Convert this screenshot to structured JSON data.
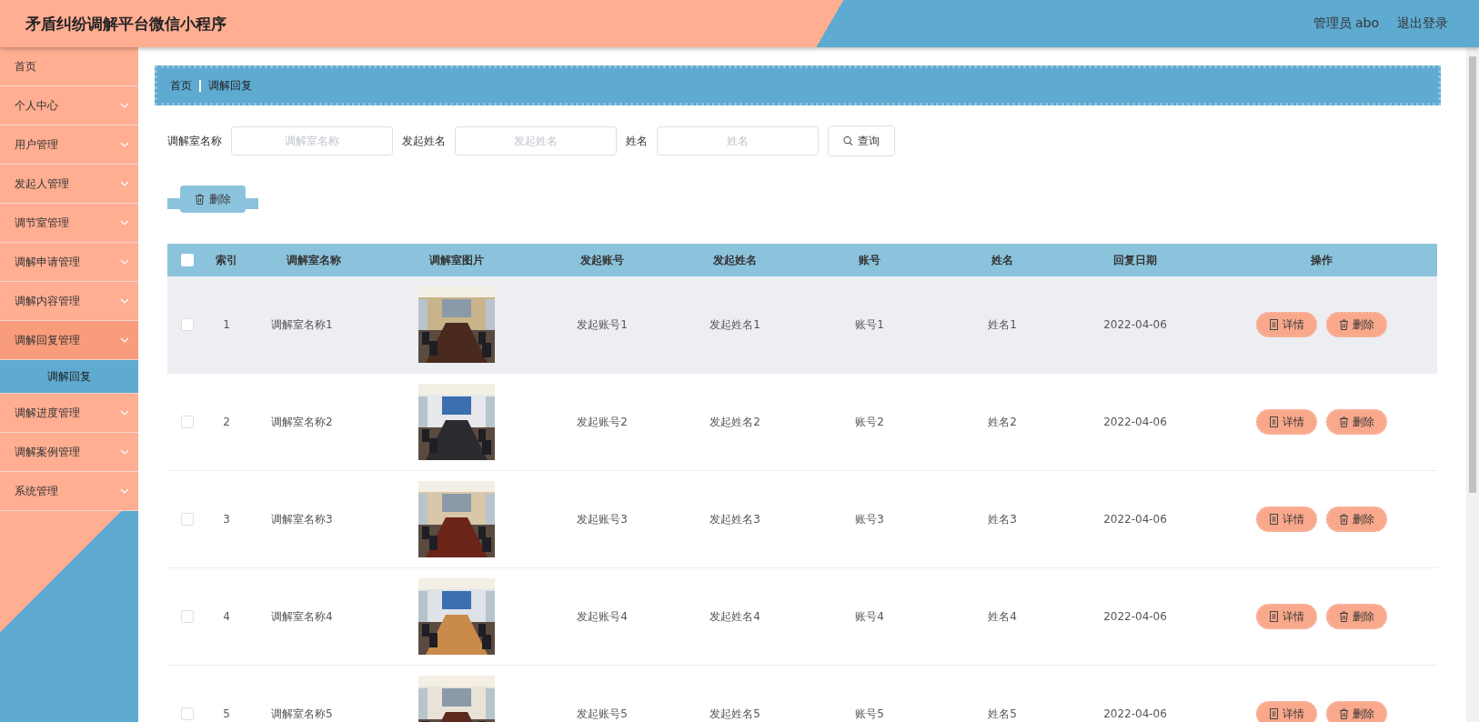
{
  "header": {
    "title": "矛盾纠纷调解平台微信小程序",
    "user": "管理员 abo",
    "logout": "退出登录"
  },
  "sidebar": {
    "items": [
      {
        "label": "首页",
        "expandable": false,
        "expanded": false
      },
      {
        "label": "个人中心",
        "expandable": true,
        "expanded": false
      },
      {
        "label": "用户管理",
        "expandable": true,
        "expanded": false
      },
      {
        "label": "发起人管理",
        "expandable": true,
        "expanded": false
      },
      {
        "label": "调节室管理",
        "expandable": true,
        "expanded": false
      },
      {
        "label": "调解申请管理",
        "expandable": true,
        "expanded": false
      },
      {
        "label": "调解内容管理",
        "expandable": true,
        "expanded": false
      },
      {
        "label": "调解回复管理",
        "expandable": true,
        "expanded": true,
        "children": [
          {
            "label": "调解回复",
            "selected": true
          }
        ]
      },
      {
        "label": "调解进度管理",
        "expandable": true,
        "expanded": false
      },
      {
        "label": "调解案例管理",
        "expandable": true,
        "expanded": false
      },
      {
        "label": "系统管理",
        "expandable": true,
        "expanded": false
      }
    ]
  },
  "breadcrumb": [
    "首页",
    "调解回复"
  ],
  "search": {
    "fields": [
      {
        "label": "调解室名称",
        "placeholder": "调解室名称"
      },
      {
        "label": "发起姓名",
        "placeholder": "发起姓名"
      },
      {
        "label": "姓名",
        "placeholder": "姓名"
      }
    ],
    "button": "查询"
  },
  "delete_button": "删除",
  "table": {
    "all_checked": false,
    "columns": [
      "索引",
      "调解室名称",
      "调解室图片",
      "发起账号",
      "发起姓名",
      "账号",
      "姓名",
      "回复日期",
      "操作"
    ],
    "rows": [
      {
        "checked": false,
        "hovered": true,
        "index": "1",
        "room": "调解室名称1",
        "image": {
          "kind": "picture"
        },
        "initiator_account": "发起账号1",
        "initiator_name": "发起姓名1",
        "account": "账号1",
        "name": "姓名1",
        "date": "2022-04-06",
        "actions": [
          "详情",
          "删除"
        ]
      },
      {
        "checked": false,
        "hovered": false,
        "index": "2",
        "room": "调解室名称2",
        "image": {
          "kind": "picture"
        },
        "initiator_account": "发起账号2",
        "initiator_name": "发起姓名2",
        "account": "账号2",
        "name": "姓名2",
        "date": "2022-04-06",
        "actions": [
          "详情",
          "删除"
        ]
      },
      {
        "checked": false,
        "hovered": false,
        "index": "3",
        "room": "调解室名称3",
        "image": {
          "kind": "picture"
        },
        "initiator_account": "发起账号3",
        "initiator_name": "发起姓名3",
        "account": "账号3",
        "name": "姓名3",
        "date": "2022-04-06",
        "actions": [
          "详情",
          "删除"
        ]
      },
      {
        "checked": false,
        "hovered": false,
        "index": "4",
        "room": "调解室名称4",
        "image": {
          "kind": "picture"
        },
        "initiator_account": "发起账号4",
        "initiator_name": "发起姓名4",
        "account": "账号4",
        "name": "姓名4",
        "date": "2022-04-06",
        "actions": [
          "详情",
          "删除"
        ]
      },
      {
        "checked": false,
        "hovered": false,
        "index": "5",
        "room": "调解室名称5",
        "image": {
          "kind": "picture"
        },
        "initiator_account": "发起账号5",
        "initiator_name": "发起姓名5",
        "account": "账号5",
        "name": "姓名5",
        "date": "2022-04-06",
        "actions": [
          "详情",
          "删除"
        ]
      }
    ]
  }
}
